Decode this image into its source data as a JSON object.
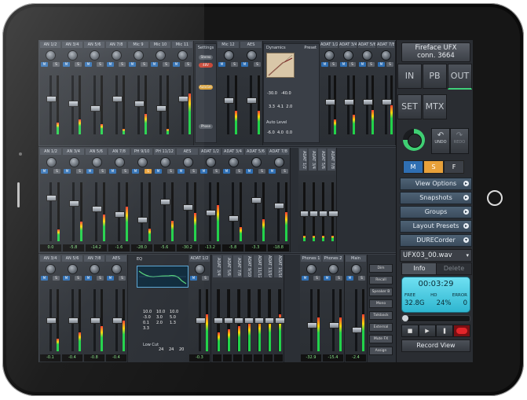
{
  "device": {
    "name": "Fireface UFX",
    "conn": "conn. 3664"
  },
  "nav_tiles": [
    "IN",
    "PB",
    "OUT",
    "SET",
    "MTX"
  ],
  "undo_label": "UNDO",
  "redo_label": "REDO",
  "modes": [
    "M",
    "S",
    "F"
  ],
  "menu": [
    "View Options",
    "Snapshots",
    "Groups",
    "Layout Presets",
    "DURECorder"
  ],
  "recorder": {
    "file": "UFX03_00.wav",
    "info_tab": "Info",
    "delete_tab": "Delete",
    "time": "00:03:29",
    "free_label": "FREE",
    "free_value": "32.8G",
    "hd_label": "HD",
    "hd_value": "24%",
    "error_label": "ERROR",
    "error_value": "0",
    "record_view": "Record View"
  },
  "row1": {
    "channels": [
      "AN 1/2",
      "AN 3/4",
      "AN 5/6",
      "AN 7/8",
      "Mic 9",
      "Mic 10",
      "Mic 11"
    ],
    "settings_panel": {
      "title": "Settings",
      "items": [
        "Stereo",
        "48V",
        "AutoSet",
        "Phase"
      ]
    },
    "channels_b": [
      "Mic 12",
      "AES"
    ],
    "dynamics_label": "Dynamics",
    "preset_label": "Preset",
    "dyn_values": [
      "-30.0",
      "-40.0",
      "3.3",
      "4.1",
      "2.0"
    ],
    "autolevel_label": "Auto Level",
    "dyn_values_b": [
      "-6.0",
      "4.0",
      "0.0"
    ],
    "channels_c": [
      "ADAT 1/2",
      "ADAT 3/4",
      "ADAT 5/6",
      "ADAT 7/8"
    ]
  },
  "row2": {
    "channels": [
      "AN 1/2",
      "AN 3/4",
      "AN 5/6",
      "AN 7/8",
      "PH 9/10",
      "PH 11/12",
      "AES",
      "ADAT 1/2",
      "ADAT 3/4",
      "ADAT 5/6",
      "ADAT 7/8"
    ],
    "adat_labels": [
      "ADAT 1/2",
      "ADAT 3/4",
      "ADAT 5/6",
      "ADAT 7/8"
    ],
    "footer": [
      "0.0",
      "-5.8",
      "-14.2",
      "-1.6",
      "-28.0",
      "-5.6",
      "-30.2",
      "-13.2",
      "-5.8",
      "-3.3",
      "-18.8"
    ]
  },
  "row3": {
    "channels": [
      "AN 3/4",
      "AN 5/6",
      "AN 7/8",
      "AES",
      "ADAT 1/2"
    ],
    "eq_label": "EQ",
    "eq_values": [
      "10.0",
      "10.0",
      "10.0",
      "-3.0",
      "3.0",
      "5.0",
      "0.1",
      "2.0",
      "1.3",
      "3.3"
    ],
    "lowcut_label": "Low Cut",
    "lowcut_values": [
      "24",
      "24",
      "20"
    ],
    "adat_labels": [
      "ADAT 3/4",
      "ADAT 5/6",
      "ADAT 7/8",
      "ADAT 9/10",
      "ADAT 11/12",
      "ADAT 13/14",
      "ADAT 15/16"
    ],
    "phones": [
      "Phones 1",
      "Phones 2"
    ],
    "main": "Main",
    "side_buttons": [
      "Dim",
      "Recall",
      "Speaker B",
      "Mono",
      "Talkback",
      "External",
      "Mute FX",
      "Assign"
    ],
    "footer": [
      "-0.1",
      "-0.4",
      "-0.8",
      "-0.4",
      "-0.3",
      "-0.7",
      "0.4"
    ],
    "phones_footer": [
      "-32.9",
      "-15.4",
      "-2.4"
    ]
  },
  "colors": {
    "accent_blue": "#2f6fb3",
    "solo": "#e8a13a",
    "rec": "#e2252a",
    "lcd": "#3ec3dc"
  }
}
